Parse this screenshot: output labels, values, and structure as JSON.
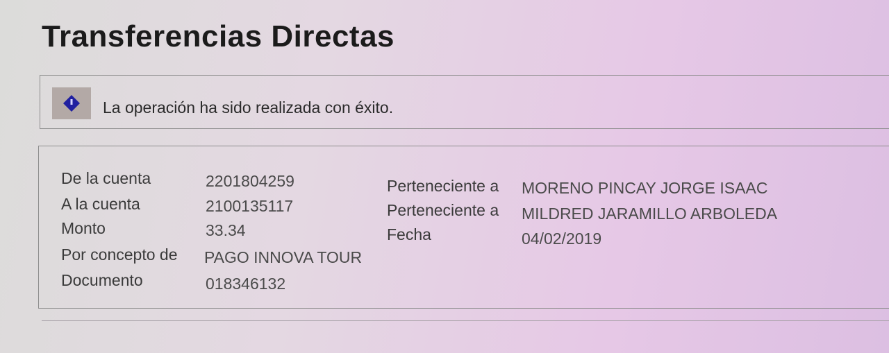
{
  "page": {
    "title": "Transferencias Directas"
  },
  "message": {
    "icon": "info-icon",
    "text": "La operación ha sido realizada con éxito."
  },
  "details": {
    "from_label": "De la cuenta",
    "from_value": "2201804259",
    "to_label": "A la cuenta",
    "to_value": "2100135117",
    "amount_label": "Monto",
    "amount_value": "33.34",
    "concept_label": "Por concepto de",
    "concept_value": "PAGO INNOVA TOUR",
    "document_label": "Documento",
    "document_value": "018346132",
    "from_owner_label": "Perteneciente a",
    "from_owner_value": "MORENO PINCAY JORGE ISAAC",
    "to_owner_label": "Perteneciente a",
    "to_owner_value": "MILDRED JARAMILLO ARBOLEDA",
    "date_label": "Fecha",
    "date_value": "04/02/2019"
  }
}
